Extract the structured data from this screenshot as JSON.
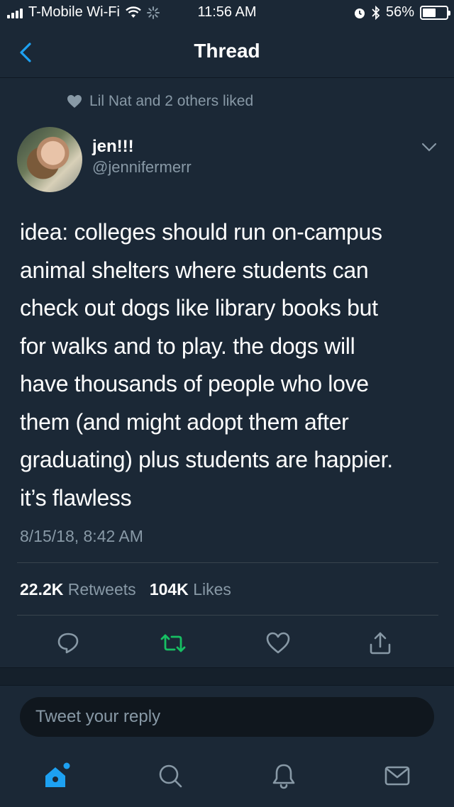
{
  "status_bar": {
    "carrier": "T-Mobile Wi-Fi",
    "time": "11:56 AM",
    "battery_percent": "56%",
    "battery_level": 0.56
  },
  "nav": {
    "title": "Thread"
  },
  "tweet": {
    "social_context": "Lil Nat and 2 others liked",
    "author_name": "jen!!!",
    "author_handle": "@jennifermerr",
    "lines": [
      "idea: colleges should run on-campus",
      "animal shelters where students can",
      "check out dogs like library books but",
      "for walks and to play. the dogs will",
      "have thousands of people who love",
      "them (and might adopt them after",
      "graduating) plus students are happier.",
      "it’s flawless"
    ],
    "timestamp": "8/15/18, 8:42 AM",
    "retweet_count": "22.2K",
    "retweet_label": "Retweets",
    "like_count": "104K",
    "like_label": "Likes"
  },
  "reply": {
    "placeholder": "Tweet your reply"
  },
  "colors": {
    "background": "#1b2836",
    "secondary_text": "#8899a6",
    "accent": "#1da1f2",
    "retweet_green": "#17bf63"
  }
}
